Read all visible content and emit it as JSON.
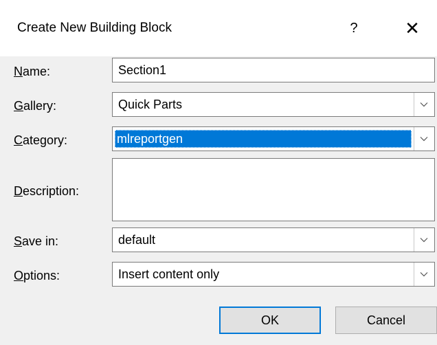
{
  "dialog": {
    "title": "Create New Building Block",
    "help_label": "?",
    "close_label": "✕"
  },
  "fields": {
    "name": {
      "label_u": "N",
      "label_rest": "ame:",
      "value": "Section1"
    },
    "gallery": {
      "label_u": "G",
      "label_rest": "allery:",
      "value": "Quick Parts"
    },
    "category": {
      "label_u": "C",
      "label_rest": "ategory:",
      "value": "mlreportgen"
    },
    "description": {
      "label_u": "D",
      "label_rest": "escription:",
      "value": ""
    },
    "save_in": {
      "label_u": "S",
      "label_rest": "ave in:",
      "value": "default"
    },
    "options": {
      "label_u": "O",
      "label_rest": "ptions:",
      "value": "Insert content only"
    }
  },
  "buttons": {
    "ok": "OK",
    "cancel": "Cancel"
  },
  "icons": {
    "dropdown": "chevron-down-icon"
  },
  "colors": {
    "selection": "#0078d7",
    "default_button_border": "#0078d7"
  }
}
